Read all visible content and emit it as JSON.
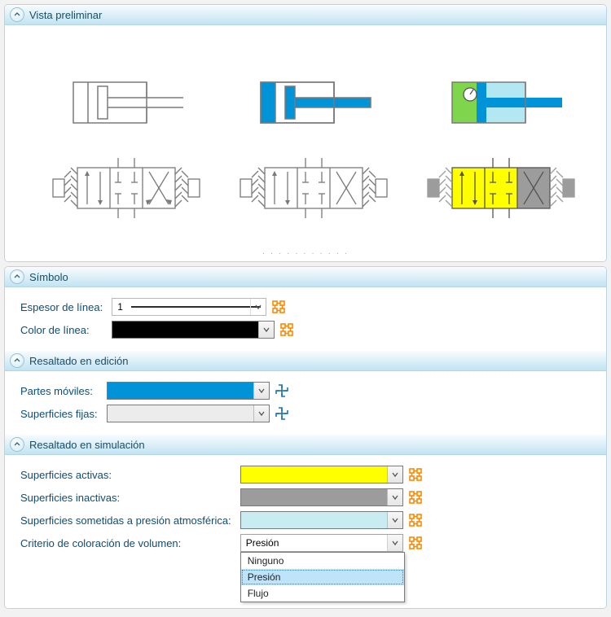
{
  "preview": {
    "title": "Vista preliminar"
  },
  "symbol": {
    "title": "Símbolo",
    "line_thickness_label": "Espesor de línea:",
    "line_thickness_value": "1",
    "line_color_label": "Color de línea:",
    "line_color_value": "#000000"
  },
  "edit_highlight": {
    "title": "Resaltado en edición",
    "moving_parts_label": "Partes móviles:",
    "moving_parts_color": "#0093d8",
    "fixed_surfaces_label": "Superficies fijas:",
    "fixed_surfaces_color": "#ececec"
  },
  "sim_highlight": {
    "title": "Resaltado en simulación",
    "active_label": "Superficies activas:",
    "active_color": "#ffff00",
    "inactive_label": "Superficies inactivas:",
    "inactive_color": "#9c9c9c",
    "atm_label": "Superficies sometidas a presión atmosférica:",
    "atm_color": "#c9ecf3",
    "criterion_label": "Criterio de coloración de volumen:",
    "criterion_value": "Presión",
    "criterion_options": [
      "Ninguno",
      "Presión",
      "Flujo"
    ]
  },
  "colors": {
    "accent_blue": "#0093d8",
    "icon_orange": "#ff8800",
    "preview_outline": "#7a7a7a",
    "preview_green": "#7fd64d",
    "preview_yellow": "#ffff00",
    "preview_gray": "#9c9c9c",
    "preview_cyan": "#b3e7f2"
  }
}
